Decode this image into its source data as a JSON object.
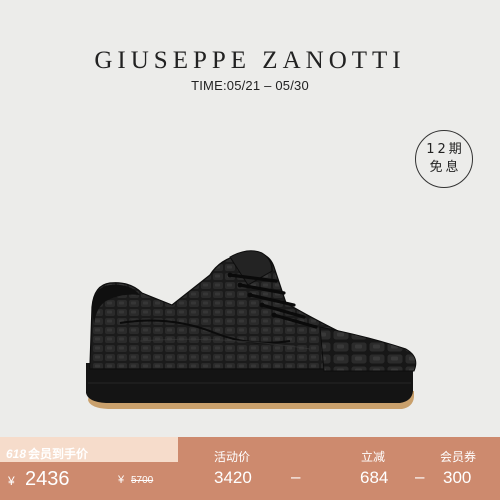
{
  "header": {
    "brand": "GIUSEPPE ZANOTTI",
    "time": "TIME:05/21 – 05/30"
  },
  "badge": {
    "line1": "12期",
    "line2": "免息"
  },
  "product": {
    "image": "black-croc-embossed-leather-sneaker"
  },
  "price_bar": {
    "tag_number": "618",
    "tag_label": "会员到手价",
    "currency": "¥",
    "price": "2436",
    "original_currency": "¥",
    "original_price": "5700",
    "columns": [
      {
        "label": "活动价",
        "value": "3420"
      },
      {
        "label": "立减",
        "value": "684"
      },
      {
        "label": "会员券",
        "value": "300"
      }
    ],
    "operators": [
      "–",
      "–"
    ]
  },
  "colors": {
    "background": "#ececea",
    "bar": "#cd8a6e",
    "bar_light": "#f6dccb",
    "text_dark": "#222222"
  }
}
